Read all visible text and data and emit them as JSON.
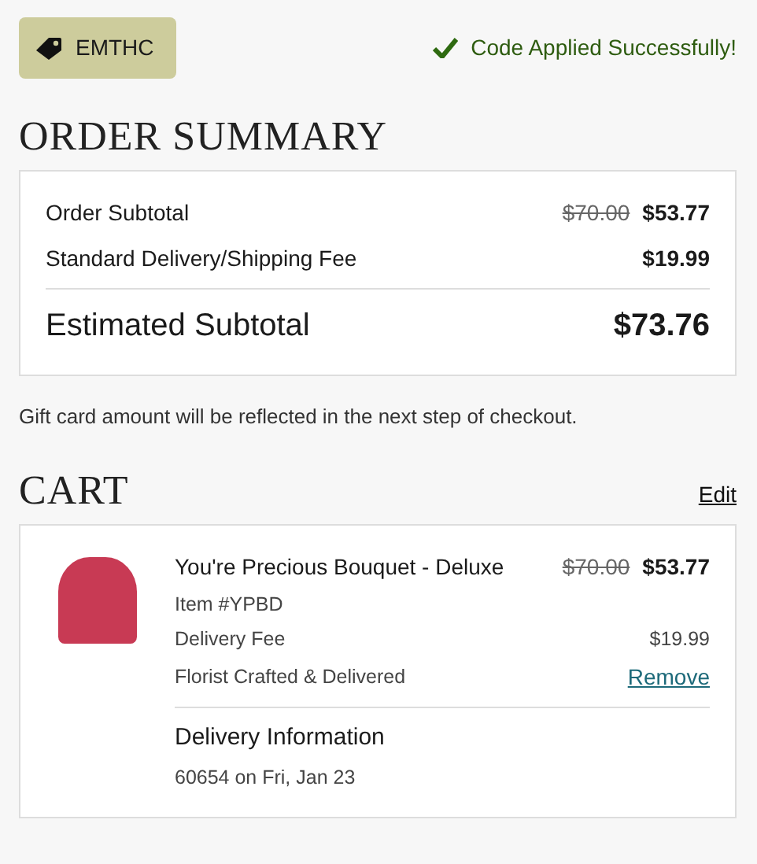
{
  "coupon": {
    "code": "EMTHC"
  },
  "status": {
    "message": "Code Applied Successfully!"
  },
  "order_summary": {
    "title": "ORDER SUMMARY",
    "lines": [
      {
        "label": "Order Subtotal",
        "original_price": "$70.00",
        "price": "$53.77"
      },
      {
        "label": "Standard Delivery/Shipping Fee",
        "price": "$19.99"
      }
    ],
    "total": {
      "label": "Estimated Subtotal",
      "amount": "$73.76"
    },
    "note": "Gift card amount will be reflected in the next step of checkout."
  },
  "cart": {
    "title": "CART",
    "edit_link": "Edit",
    "items": [
      {
        "name": "You're Precious Bouquet - Deluxe",
        "original_price": "$70.00",
        "price": "$53.77",
        "item_number": "Item #YPBD",
        "fee_label": "Delivery Fee",
        "fee": "$19.99",
        "fulfilment": "Florist Crafted & Delivered",
        "remove_link": "Remove",
        "delivery_title": "Delivery Information",
        "delivery_detail": "60654 on Fri, Jan 23"
      }
    ]
  }
}
